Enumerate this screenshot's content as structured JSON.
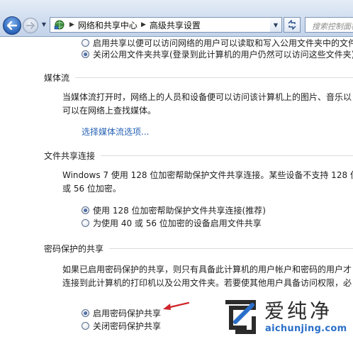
{
  "toolbar": {
    "breadcrumbs": [
      "网络和共享中心",
      "高级共享设置"
    ],
    "search_placeholder": "搜索控制面板"
  },
  "public_folder_sharing": {
    "options": [
      {
        "label": "启用共享以便可以访问网络的用户可以读取和写入公用文件夹中的文件",
        "selected": false
      },
      {
        "label": "关闭公用文件夹共享(登录到此计算机的用户仍然可以访问这些文件夹)",
        "selected": true
      }
    ]
  },
  "media_streaming": {
    "title": "媒体流",
    "description_lines": [
      "当媒体流打开时，网络上的人员和设备便可以访问该计算机上的图片、音乐以",
      "可以在网络上查找媒体。"
    ],
    "link": "选择媒体流选项..."
  },
  "file_sharing_connections": {
    "title": "文件共享连接",
    "description_lines": [
      "Windows 7 使用 128 位加密帮助保护文件共享连接。某些设备不支持 128 位",
      "或 56 位加密。"
    ],
    "options": [
      {
        "label": "使用 128 位加密帮助保护文件共享连接(推荐)",
        "selected": true
      },
      {
        "label": "为使用 40 或 56 位加密的设备启用文件共享",
        "selected": false
      }
    ]
  },
  "password_protected_sharing": {
    "title": "密码保护的共享",
    "description_lines": [
      "如果已启用密码保护的共享，则只有具备此计算机的用户帐户和密码的用户才",
      "连接到此计算机的打印机以及公用文件夹。若要使其他用户具备访问权限，必"
    ],
    "options": [
      {
        "label": "启用密码保护共享",
        "selected": true
      },
      {
        "label": "关闭密码保护共享",
        "selected": false
      }
    ]
  },
  "colors": {
    "link": "#2964b5",
    "arrow": "#d0242a",
    "watermark_url": "#2a6fc9"
  },
  "watermark": {
    "brand": "爱纯净",
    "url": "aichunjing.com"
  }
}
